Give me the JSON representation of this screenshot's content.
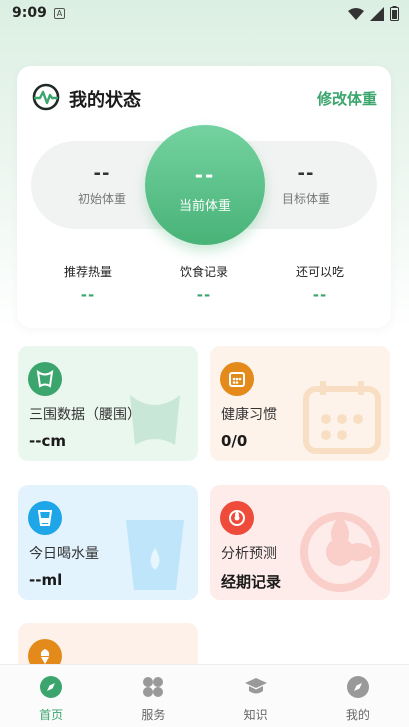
{
  "status_bar": {
    "time": "9:09",
    "notification_glyph": "A"
  },
  "status_card": {
    "title": "我的状态",
    "edit_label": "修改体重",
    "initial_weight": {
      "value": "--",
      "label": "初始体重"
    },
    "current_weight": {
      "value": "--",
      "label": "当前体重"
    },
    "target_weight": {
      "value": "--",
      "label": "目标体重"
    },
    "metrics": [
      {
        "label": "推荐热量",
        "value": "--"
      },
      {
        "label": "饮食记录",
        "value": "--"
      },
      {
        "label": "还可以吃",
        "value": "--"
      }
    ]
  },
  "features": [
    {
      "title": "三围数据（腰围）",
      "value": "--cm",
      "icon": "waist-icon",
      "color": "#3ba56d"
    },
    {
      "title": "健康习惯",
      "value": "0/0",
      "icon": "calendar-icon",
      "color": "#e48a1b"
    },
    {
      "title": "今日喝水量",
      "value": "--ml",
      "icon": "water-cup-icon",
      "color": "#1ea6e8"
    },
    {
      "title": "分析预测",
      "value": "经期记录",
      "icon": "flower-icon",
      "color": "#ee4b3b"
    },
    {
      "title": "",
      "value": "",
      "icon": "ice-cream-icon",
      "color": "#e48a1b"
    }
  ],
  "bottom_nav": [
    {
      "label": "首页",
      "icon": "compass-icon",
      "active": true
    },
    {
      "label": "服务",
      "icon": "grid-icon",
      "active": false
    },
    {
      "label": "知识",
      "icon": "graduation-cap-icon",
      "active": false
    },
    {
      "label": "我的",
      "icon": "compass-icon",
      "active": false
    }
  ],
  "colors": {
    "accent": "#3ba56d",
    "accent_light": "#74d2a0"
  }
}
